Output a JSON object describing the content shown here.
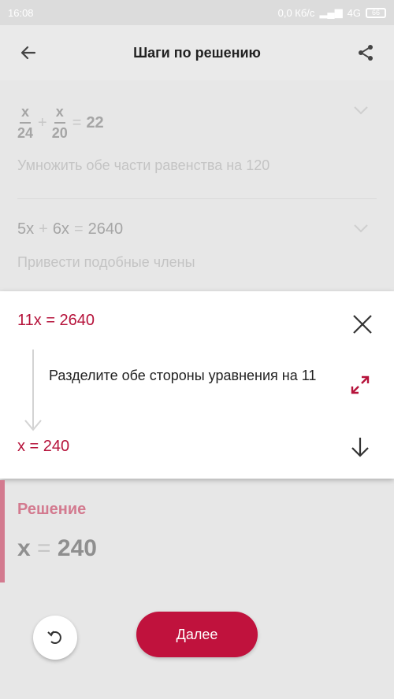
{
  "status_bar": {
    "time": "16:08",
    "network_speed": "0,0 Кб/с",
    "network_type": "4G",
    "battery": "66"
  },
  "app_bar": {
    "title": "Шаги по решению",
    "back_icon": "arrow-left-icon",
    "share_icon": "share-icon"
  },
  "steps": [
    {
      "equation": {
        "frac1_num": "x",
        "frac1_den": "24",
        "plus": "+",
        "frac2_num": "x",
        "frac2_den": "20",
        "equals": "=",
        "rhs": "22"
      },
      "hint": "Умножить обе части равенства на 120"
    },
    {
      "equation": {
        "t1": "5x",
        "plus": "+",
        "t2": "6x",
        "equals": "=",
        "rhs": "2640"
      },
      "hint": "Привести подобные члены"
    }
  ],
  "active_step": {
    "top_equation": "11x = 2640",
    "description": "Разделите обе стороны уравнения на 11",
    "bottom_equation": "x = 240"
  },
  "solution": {
    "label": "Решение",
    "lhs": "x",
    "equals": "=",
    "rhs": "240"
  },
  "buttons": {
    "next_label": "Далее"
  },
  "colors": {
    "accent": "#c0123d",
    "accent_light": "#d37a8f"
  }
}
